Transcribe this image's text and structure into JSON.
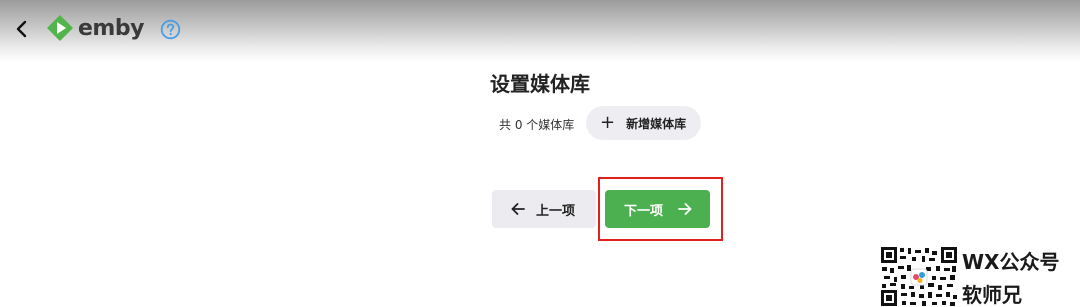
{
  "header": {
    "back_icon": "chevron-left-icon",
    "logo_text": "emby",
    "brand_color": "#52b54b",
    "help_icon": "question-circle-icon",
    "help_color": "#4a9de0"
  },
  "main": {
    "title": "设置媒体库",
    "library_count": "共 0 个媒体库",
    "add_button": {
      "label": "新增媒体库",
      "icon": "plus-icon"
    }
  },
  "nav": {
    "prev": {
      "label": "上一项",
      "icon": "arrow-left-icon"
    },
    "next": {
      "label": "下一项",
      "icon": "arrow-right-icon",
      "color": "#4caf50"
    }
  },
  "annotation": {
    "highlight_color": "#e1201f"
  },
  "watermark": {
    "line1": "WX公众号",
    "line2": "软师兄"
  }
}
